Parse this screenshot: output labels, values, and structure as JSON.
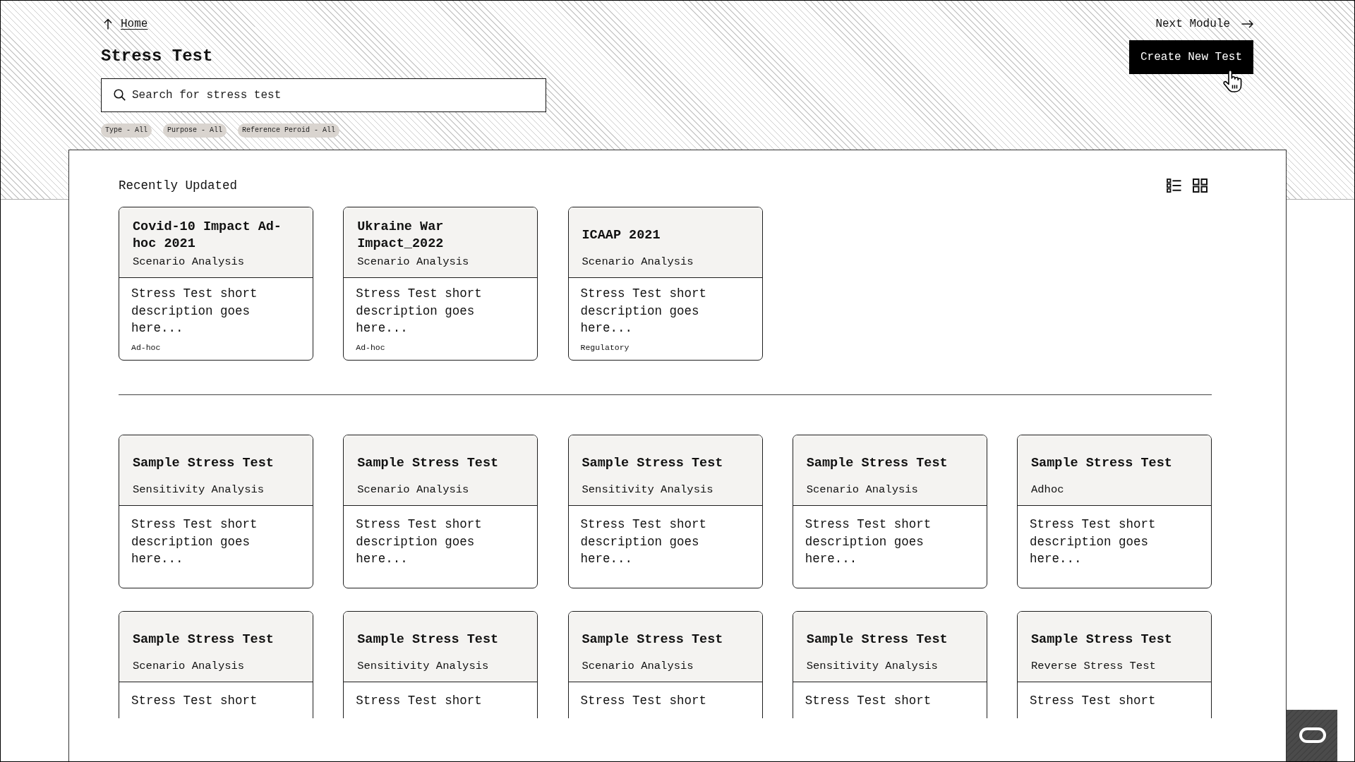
{
  "navigation": {
    "back_link": "Home",
    "next_link": "Next Module"
  },
  "title": "Stress Test",
  "create_button": "Create New Test",
  "search": {
    "placeholder": "Search for stress test"
  },
  "filters": [
    "Type - All",
    "Purpose - All",
    "Reference Peroid - All"
  ],
  "recently_updated": {
    "heading": "Recently Updated",
    "cards": [
      {
        "title": "Covid-10 Impact Ad-hoc 2021",
        "type": "Scenario Analysis",
        "description": "Stress Test short description goes here...",
        "category": "Ad-hoc"
      },
      {
        "title": "Ukraine War Impact_2022",
        "type": "Scenario Analysis",
        "description": "Stress Test short description goes here...",
        "category": "Ad-hoc"
      },
      {
        "title": "ICAAP 2021",
        "type": "Scenario Analysis",
        "description": "Stress Test short description goes here...",
        "category": "Regulatory"
      }
    ]
  },
  "stress_tests": [
    {
      "title": "Sample Stress Test",
      "type": "Sensitivity Analysis",
      "description": "Stress Test short description goes here..."
    },
    {
      "title": "Sample Stress Test",
      "type": "Scenario Analysis",
      "description": "Stress Test short description goes here..."
    },
    {
      "title": "Sample Stress Test",
      "type": "Sensitivity Analysis",
      "description": "Stress Test short description goes here..."
    },
    {
      "title": "Sample Stress Test",
      "type": "Scenario Analysis",
      "description": "Stress Test short description goes here..."
    },
    {
      "title": "Sample Stress Test",
      "type": "Adhoc",
      "description": "Stress Test short description goes here..."
    },
    {
      "title": "Sample Stress Test",
      "type": "Scenario Analysis",
      "description": "Stress Test short"
    },
    {
      "title": "Sample Stress Test",
      "type": "Sensitivity Analysis",
      "description": "Stress Test short"
    },
    {
      "title": "Sample Stress Test",
      "type": "Scenario Analysis",
      "description": "Stress Test short"
    },
    {
      "title": "Sample Stress Test",
      "type": "Sensitivity Analysis",
      "description": "Stress Test short"
    },
    {
      "title": "Sample Stress Test",
      "type": "Reverse Stress Test",
      "description": "Stress Test short"
    }
  ]
}
